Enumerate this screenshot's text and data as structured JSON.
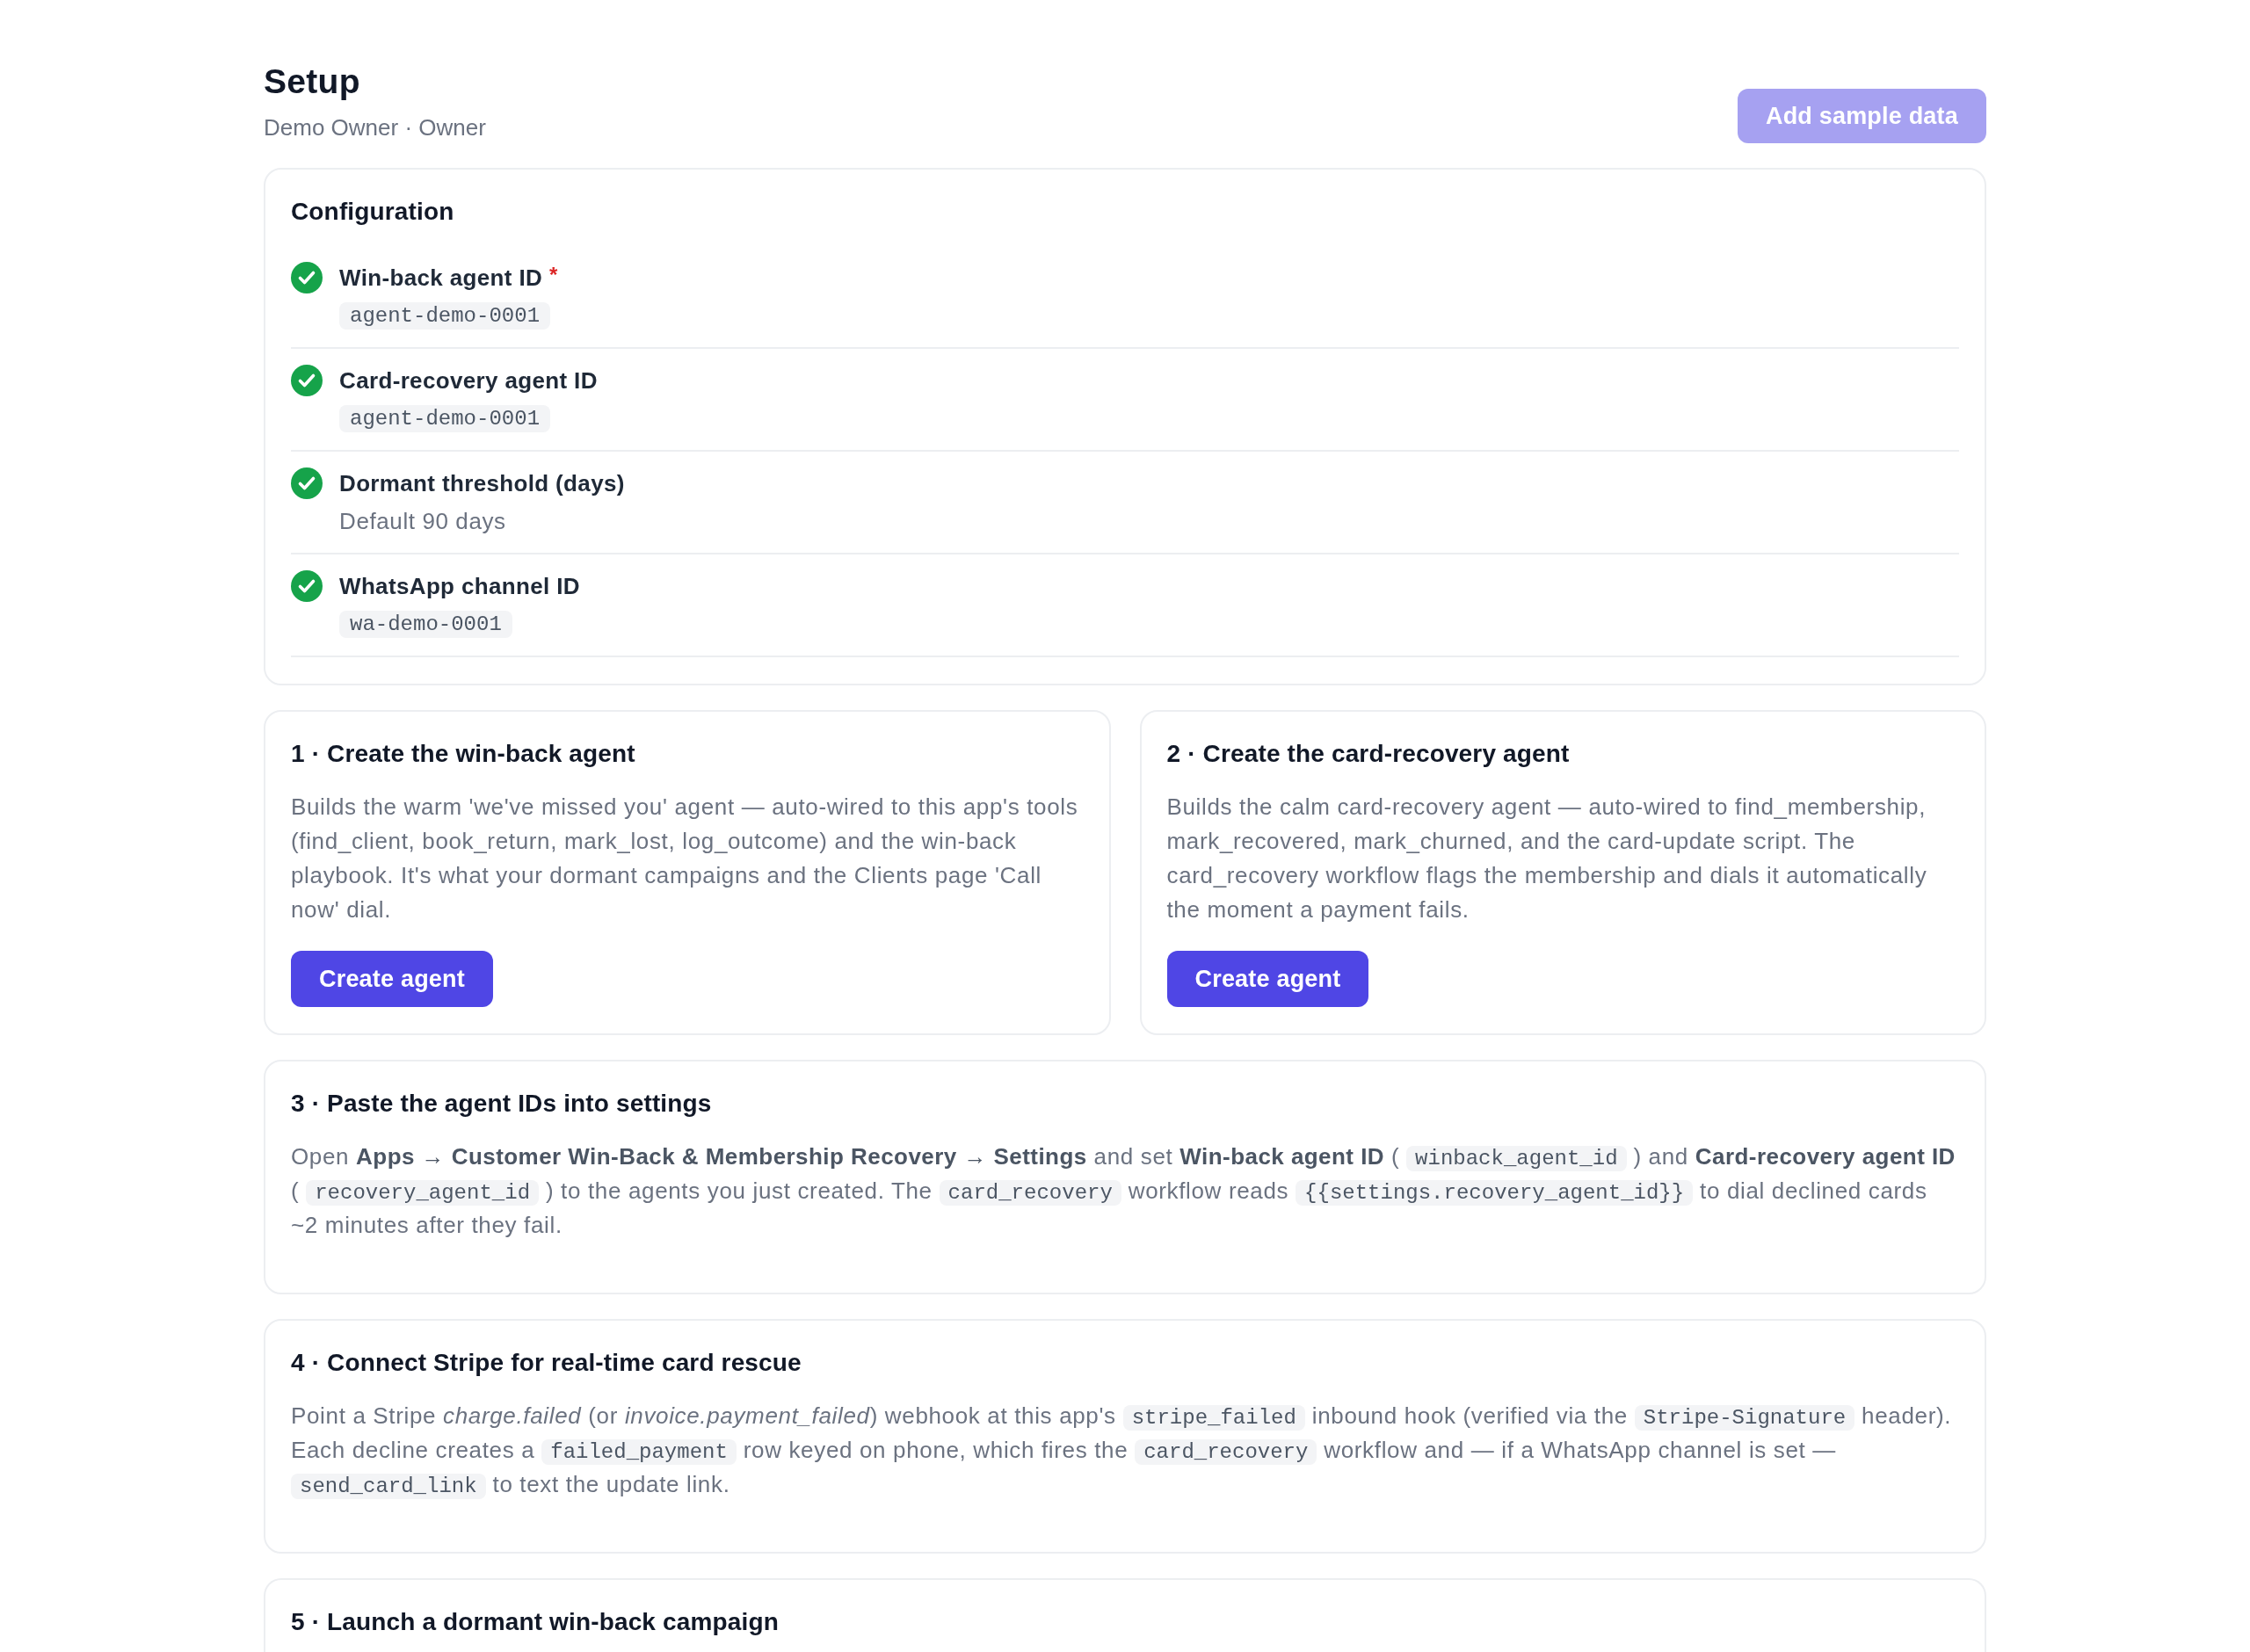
{
  "page": {
    "title": "Setup",
    "subtitle": "Demo Owner · Owner",
    "action": {
      "label": "Add sample data",
      "disabled": true
    }
  },
  "configuration": {
    "title": "Configuration",
    "items": [
      {
        "label": "Win-back agent ID",
        "required_mark": "*",
        "done": true,
        "value": {
          "kind": "code",
          "text": "agent-demo-0001"
        }
      },
      {
        "label": "Card-recovery agent ID",
        "done": true,
        "value": {
          "kind": "code",
          "text": "agent-demo-0001"
        }
      },
      {
        "label": "Dormant threshold (days)",
        "done": true,
        "value": {
          "kind": "text",
          "text": "Default 90 days"
        }
      },
      {
        "label": "WhatsApp channel ID",
        "done": true,
        "value": {
          "kind": "code",
          "text": "wa-demo-0001"
        }
      }
    ]
  },
  "agent_steps": [
    {
      "title": "1 · Create the win-back agent",
      "description": [
        {
          "kind": "text",
          "text": "Builds the warm 'we've missed you' agent — auto-wired to this app's tools (find_client, book_return, mark_lost, log_outcome) and the win-back playbook. It's what your dormant campaigns and the Clients page 'Call now' dial."
        }
      ],
      "button": {
        "label": "Create agent",
        "disabled": false
      }
    },
    {
      "title": "2 · Create the card-recovery agent",
      "description": [
        {
          "kind": "text",
          "text": "Builds the calm card-recovery agent — auto-wired to find_membership, mark_recovered, mark_churned, and the card-update script. The card_recovery workflow flags the membership and dials it automatically the moment a payment fails."
        }
      ],
      "button": {
        "label": "Create agent",
        "disabled": false
      }
    }
  ],
  "instruction_steps": [
    {
      "title": "3 · Paste the agent IDs into settings",
      "description": [
        {
          "kind": "text",
          "text": "Open **Apps → Customer Win-Back & Membership Recovery → Settings** and set **Win-back agent ID** ( "
        },
        {
          "kind": "code",
          "text": "winback_agent_id"
        },
        {
          "kind": "text",
          "text": " ) and **Card-recovery agent ID** ( "
        },
        {
          "kind": "code",
          "text": "recovery_agent_id"
        },
        {
          "kind": "text",
          "text": " ) to the agents you just created. The "
        },
        {
          "kind": "code",
          "text": "card_recovery"
        },
        {
          "kind": "text",
          "text": " workflow reads "
        },
        {
          "kind": "code",
          "text": "{{settings.recovery_agent_id}}"
        },
        {
          "kind": "text",
          "text": " to dial declined cards ~2 minutes after they fail."
        }
      ]
    },
    {
      "title": "4 · Connect Stripe for real-time card rescue",
      "description": [
        {
          "kind": "text",
          "text": "Point a Stripe *charge.failed* (or *invoice.payment_failed*) webhook at this app's "
        },
        {
          "kind": "code",
          "text": "stripe_failed"
        },
        {
          "kind": "text",
          "text": " inbound hook (verified via the "
        },
        {
          "kind": "code",
          "text": "Stripe-Signature"
        },
        {
          "kind": "text",
          "text": " header). Each decline creates a "
        },
        {
          "kind": "code",
          "text": "failed_payment"
        },
        {
          "kind": "text",
          "text": " row keyed on phone, which fires the "
        },
        {
          "kind": "code",
          "text": "card_recovery"
        },
        {
          "kind": "text",
          "text": " workflow and — if a WhatsApp channel is set — "
        },
        {
          "kind": "code",
          "text": "send_card_link"
        },
        {
          "kind": "text",
          "text": " to text the update link."
        }
      ]
    },
    {
      "title": "5 · Launch a dormant win-back campaign"
    }
  ]
}
